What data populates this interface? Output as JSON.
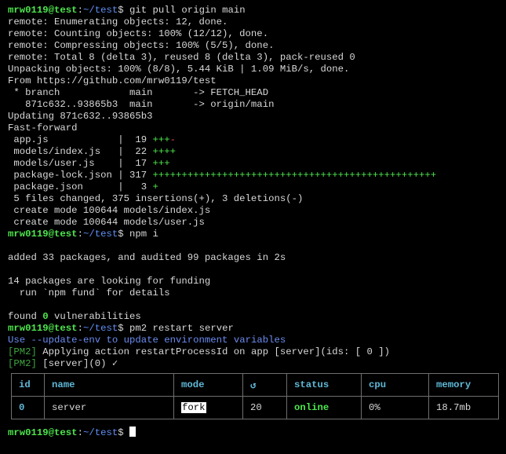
{
  "prompt": {
    "user_host": "mrw0119@test",
    "colon": ":",
    "path": "~/test",
    "dollar": "$"
  },
  "commands": {
    "cmd1": "git pull origin main",
    "cmd2": "npm i",
    "cmd3": "pm2 restart server"
  },
  "git_output": [
    "remote: Enumerating objects: 12, done.",
    "remote: Counting objects: 100% (12/12), done.",
    "remote: Compressing objects: 100% (5/5), done.",
    "remote: Total 8 (delta 3), reused 8 (delta 3), pack-reused 0",
    "Unpacking objects: 100% (8/8), 5.44 KiB | 1.09 MiB/s, done.",
    "From https://github.com/mrw0119/test",
    " * branch            main       -> FETCH_HEAD",
    "   871c632..93865b3  main       -> origin/main",
    "Updating 871c632..93865b3",
    "Fast-forward"
  ],
  "diffstat": [
    {
      "file": " app.js           ",
      "sep": " | ",
      "count": " 19 ",
      "plus": "+++",
      "minus": "-"
    },
    {
      "file": " models/index.js  ",
      "sep": " | ",
      "count": " 22 ",
      "plus": "++++",
      "minus": ""
    },
    {
      "file": " models/user.js   ",
      "sep": " | ",
      "count": " 17 ",
      "plus": "+++",
      "minus": ""
    },
    {
      "file": " package-lock.json",
      "sep": " | ",
      "count": "317 ",
      "plus": "+++++++++++++++++++++++++++++++++++++++++++++++++",
      "minus": ""
    },
    {
      "file": " package.json     ",
      "sep": " | ",
      "count": "  3 ",
      "plus": "+",
      "minus": ""
    }
  ],
  "git_summary": [
    " 5 files changed, 375 insertions(+), 3 deletions(-)",
    " create mode 100644 models/index.js",
    " create mode 100644 models/user.js"
  ],
  "npm_output": {
    "added": "added 33 packages, and audited 99 packages in 2s",
    "funding": "14 packages are looking for funding",
    "fund_hint": "  run `npm fund` for details",
    "found_prefix": "found ",
    "found_zero": "0",
    "found_suffix": " vulnerabilities"
  },
  "pm2_output": {
    "hint_prefix": "Use ",
    "hint_flag": "--update-env",
    "hint_suffix": " to update environment variables",
    "tag": "[PM2]",
    "line1": " Applying action restartProcessId on app [server](ids: [ 0 ])",
    "line2": " [server](0) ✓"
  },
  "table": {
    "headers": {
      "id": "id",
      "name": "name",
      "mode": "mode",
      "restart": "↺",
      "status": "status",
      "cpu": "cpu",
      "memory": "memory"
    },
    "rows": [
      {
        "id": "0",
        "name": "server",
        "mode": "fork",
        "restart": "20",
        "status": "online",
        "cpu": "0%",
        "memory": "18.7mb"
      }
    ]
  },
  "colors": {
    "prompt_green": "#4ee64e",
    "path_blue": "#5f8ff5",
    "header_cyan": "#5fb8d8",
    "pm2_tag_green": "#3fa640",
    "minus_red": "#e34a4a"
  }
}
